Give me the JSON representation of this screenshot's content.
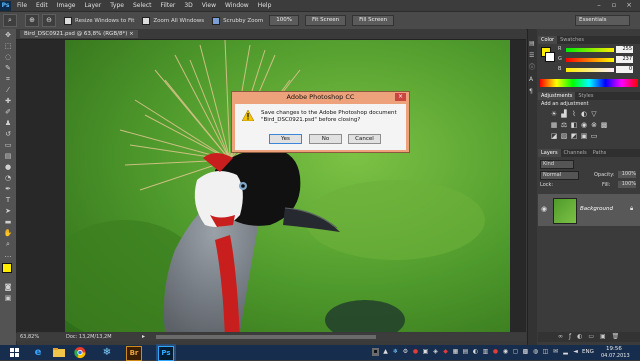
{
  "menubar": {
    "logo": "Ps",
    "items": [
      "File",
      "Edit",
      "Image",
      "Layer",
      "Type",
      "Select",
      "Filter",
      "3D",
      "View",
      "Window",
      "Help"
    ]
  },
  "options": {
    "resize_label": "Resize Windows to Fit",
    "zoom_all_label": "Zoom All Windows",
    "scrubby_label": "Scrubby Zoom",
    "btn_100": "100%",
    "btn_fit": "Fit Screen",
    "btn_fill": "Fill Screen",
    "workspace": "Essentials"
  },
  "document": {
    "tab_title": "Bird_DSC0921.psd @ 63,8% (RGB/8*) ×",
    "zoom": "63,82%",
    "doc_info": "Doc: 13,2M/13,2M"
  },
  "color_panel": {
    "tabs": [
      "Color",
      "Swatches"
    ],
    "r": "255",
    "g": "237",
    "b": "0",
    "fg_color": "#ffed00"
  },
  "adjustments": {
    "tabs": [
      "Adjustments",
      "Styles"
    ],
    "header": "Add an adjustment"
  },
  "layers": {
    "tabs": [
      "Layers",
      "Channels",
      "Paths"
    ],
    "filter": "Kind",
    "blend": "Normal",
    "opacity_label": "Opacity:",
    "opacity": "100%",
    "lock_label": "Lock:",
    "fill_label": "Fill:",
    "fill": "100%",
    "layer_name": "Background"
  },
  "dialog": {
    "title": "Adobe Photoshop CC",
    "message_line1": "Save changes to the Adobe Photoshop document",
    "message_line2": "\"Bird_DSC0921.psd\" before closing?",
    "yes": "Yes",
    "no": "No",
    "cancel": "Cancel"
  },
  "taskbar": {
    "lang": "ENG",
    "time": "19:56",
    "date": "04.07.2013",
    "apps": [
      "windows-icon",
      "ie-icon",
      "explorer-icon",
      "chrome-icon",
      "snowflake-app-icon",
      "bridge-icon",
      "photoshop-icon"
    ],
    "bridge_label": "Br",
    "ps_label": "Ps"
  }
}
